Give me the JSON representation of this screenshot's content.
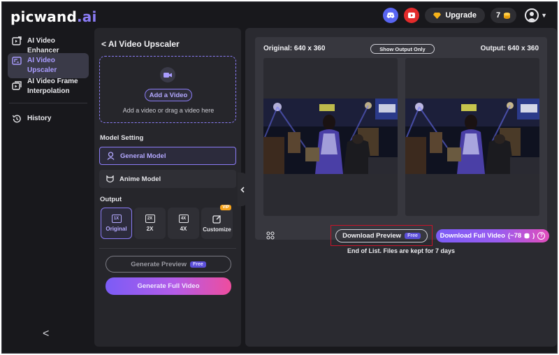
{
  "app": {
    "logo_text": "picwand",
    "logo_suffix": ".ai",
    "upgrade_label": "Upgrade",
    "credits": "7"
  },
  "sidebar": {
    "items": [
      {
        "label": "AI Video Enhancer",
        "icon": "video-enhance-icon"
      },
      {
        "label": "AI Video Upscaler",
        "icon": "video-upscale-icon"
      },
      {
        "label": "AI Video Frame Interpolation",
        "icon": "frame-interpolation-icon"
      },
      {
        "label": "History",
        "icon": "history-icon"
      }
    ],
    "collapse_glyph": "<"
  },
  "left_panel": {
    "title": "< AI Video Upscaler",
    "add_video_label": "Add a Video",
    "upload_hint": "Add a video or drag a video here",
    "model_setting_label": "Model Setting",
    "models": [
      "General Model",
      "Anime Model"
    ],
    "output_label": "Output",
    "output_options": [
      {
        "badge": "1X",
        "label": "Original"
      },
      {
        "badge": "2X",
        "label": "2X"
      },
      {
        "badge": "4X",
        "label": "4X"
      },
      {
        "badge": "",
        "label": "Customize",
        "vip": "VIP"
      }
    ],
    "generate_preview_label": "Generate Preview",
    "free_badge": "Free",
    "generate_full_label": "Generate Full Video"
  },
  "compare": {
    "original_label": "Original: 640 x 360",
    "output_label": "Output: 640 x 360",
    "show_output_label": "Show Output Only",
    "download_preview_label": "Download Preview",
    "free_badge": "Free",
    "download_full_label": "Download Full Video",
    "download_full_cost": "(~78",
    "download_full_cost_end": ")",
    "end_note": "End of List. Files are kept for 7 days"
  },
  "colors": {
    "accent": "#8b7cf6",
    "pink": "#ee4d9e",
    "highlight": "#c8142a",
    "discord": "#5865f2",
    "youtube": "#e32b2b"
  }
}
